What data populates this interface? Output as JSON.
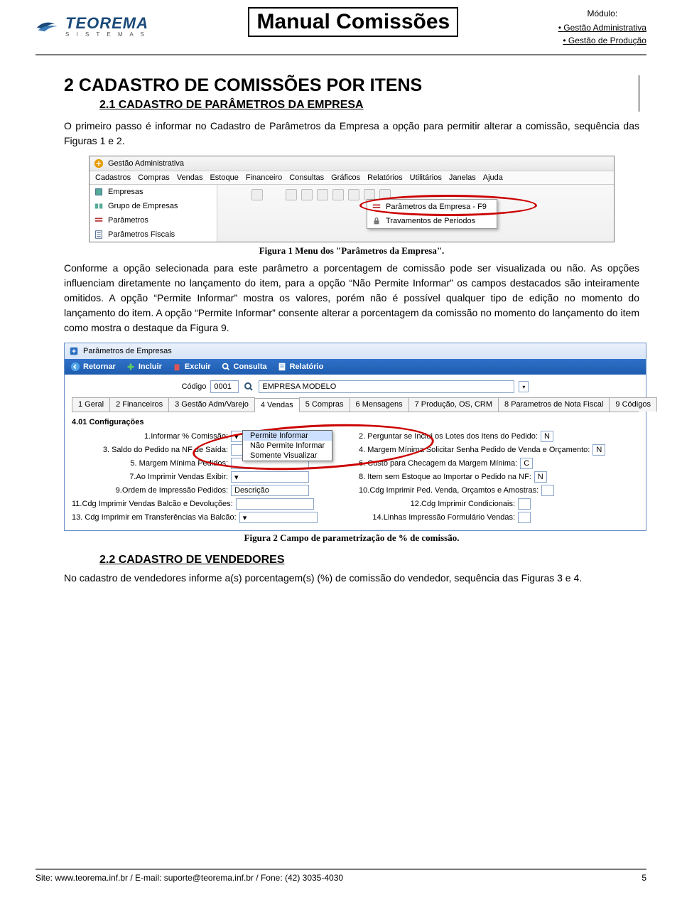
{
  "header": {
    "logo_text": "TEOREMA",
    "logo_sub": "S I S T E M A S",
    "title": "Manual Comissões",
    "module_label": "Módulo:",
    "modules": [
      "Gestão Administrativa",
      "Gestão de Produção"
    ]
  },
  "section": {
    "h1": "2  CADASTRO DE COMISSÕES POR ITENS",
    "h2": "2.1 CADASTRO DE PARÂMETROS DA EMPRESA",
    "p1": "O primeiro passo é informar no Cadastro de Parâmetros da Empresa a opção para permitir alterar a comissão, sequência das Figuras 1 e 2."
  },
  "fig1": {
    "window_title": "Gestão Administrativa",
    "menus": [
      "Cadastros",
      "Compras",
      "Vendas",
      "Estoque",
      "Financeiro",
      "Consultas",
      "Gráficos",
      "Relatórios",
      "Utilitários",
      "Janelas",
      "Ajuda"
    ],
    "side_items": [
      "Empresas",
      "Grupo de Empresas",
      "Parâmetros",
      "Parâmetros Fiscais"
    ],
    "flyout": [
      "Parâmetros da Empresa - F9",
      "Travamentos de Períodos"
    ],
    "caption": "Figura 1 Menu dos \"Parâmetros da Empresa\"."
  },
  "body2": {
    "p": "Conforme a opção selecionada para este parâmetro a porcentagem de comissão pode ser visualizada ou não. As opções influenciam diretamente no lançamento do item, para a opção “Não Permite Informar” os campos destacados são inteiramente omitidos. A opção “Permite Informar” mostra os valores, porém não é possível qualquer tipo de edição no momento do lançamento do item. A opção “Permite Informar” consente alterar a porcentagem da comissão no momento do lançamento do item como mostra o destaque da Figura 9."
  },
  "fig2": {
    "window_title": "Parâmetros de Empresas",
    "toolbar": {
      "retornar": "Retornar",
      "incluir": "Incluir",
      "excluir": "Excluir",
      "consulta": "Consulta",
      "relatorio": "Relatório"
    },
    "code_label": "Código",
    "code_value": "0001",
    "empresa": "EMPRESA MODELO",
    "tabs": [
      "1 Geral",
      "2 Financeiros",
      "3 Gestão Adm/Varejo",
      "4 Vendas",
      "5 Compras",
      "6 Mensagens",
      "7 Produção, OS, CRM",
      "8 Parametros de Nota Fiscal",
      "9 Códigos"
    ],
    "active_tab": "4 Vendas",
    "cfg_label": "4.01 Configurações",
    "fields_left": [
      {
        "n": "1",
        "label": "Informar % Comissão:",
        "value": ""
      },
      {
        "n": "3",
        "label": "Saldo do Pedido na NF de Saída:",
        "value": ""
      },
      {
        "n": "5",
        "label": "Margem Mínima Pedidos:",
        "value": ""
      },
      {
        "n": "7",
        "label": "Ao Imprimir Vendas Exibir:",
        "value": ""
      },
      {
        "n": "9",
        "label": "Ordem de Impressão Pedidos:",
        "value": "Descrição"
      },
      {
        "n": "11",
        "label": "Cdg Imprimir Vendas Balcão e Devoluções:",
        "value": ""
      },
      {
        "n": "13",
        "label": "Cdg Imprimir em Transferências via Balcão:",
        "value": ""
      }
    ],
    "fields_right": [
      {
        "n": "2",
        "label": "Perguntar se Inclui os Lotes dos Itens do Pedido:",
        "value": "N"
      },
      {
        "n": "4",
        "label": "Margem Mínima Solicitar Senha Pedido de Venda e Orçamento:",
        "value": "N"
      },
      {
        "n": "6",
        "label": "Custo para Checagem da Margem Mínima:",
        "value": "C"
      },
      {
        "n": "8",
        "label": "Item sem Estoque ao Importar o Pedido na NF:",
        "value": "N"
      },
      {
        "n": "10",
        "label": "Cdg Imprimir Ped. Venda, Orçamtos e Amostras:",
        "value": ""
      },
      {
        "n": "12",
        "label": "Cdg Imprimir Condicionais:",
        "value": ""
      },
      {
        "n": "14",
        "label": "Linhas Impressão Formulário Vendas:",
        "value": ""
      }
    ],
    "dropdown": [
      "Permite Informar",
      "Não Permite Informar",
      "Somente Visualizar"
    ],
    "caption": "Figura 2 Campo de parametrização de % de comissão."
  },
  "section22": {
    "h3": "2.2 CADASTRO DE VENDEDORES",
    "p": "No cadastro de vendedores informe a(s) porcentagem(s) (%) de comissão do vendedor, sequência das Figuras 3 e 4."
  },
  "footer": {
    "left": "Site: www.teorema.inf.br / E-mail: suporte@teorema.inf.br / Fone: (42) 3035-4030",
    "right": "5"
  }
}
